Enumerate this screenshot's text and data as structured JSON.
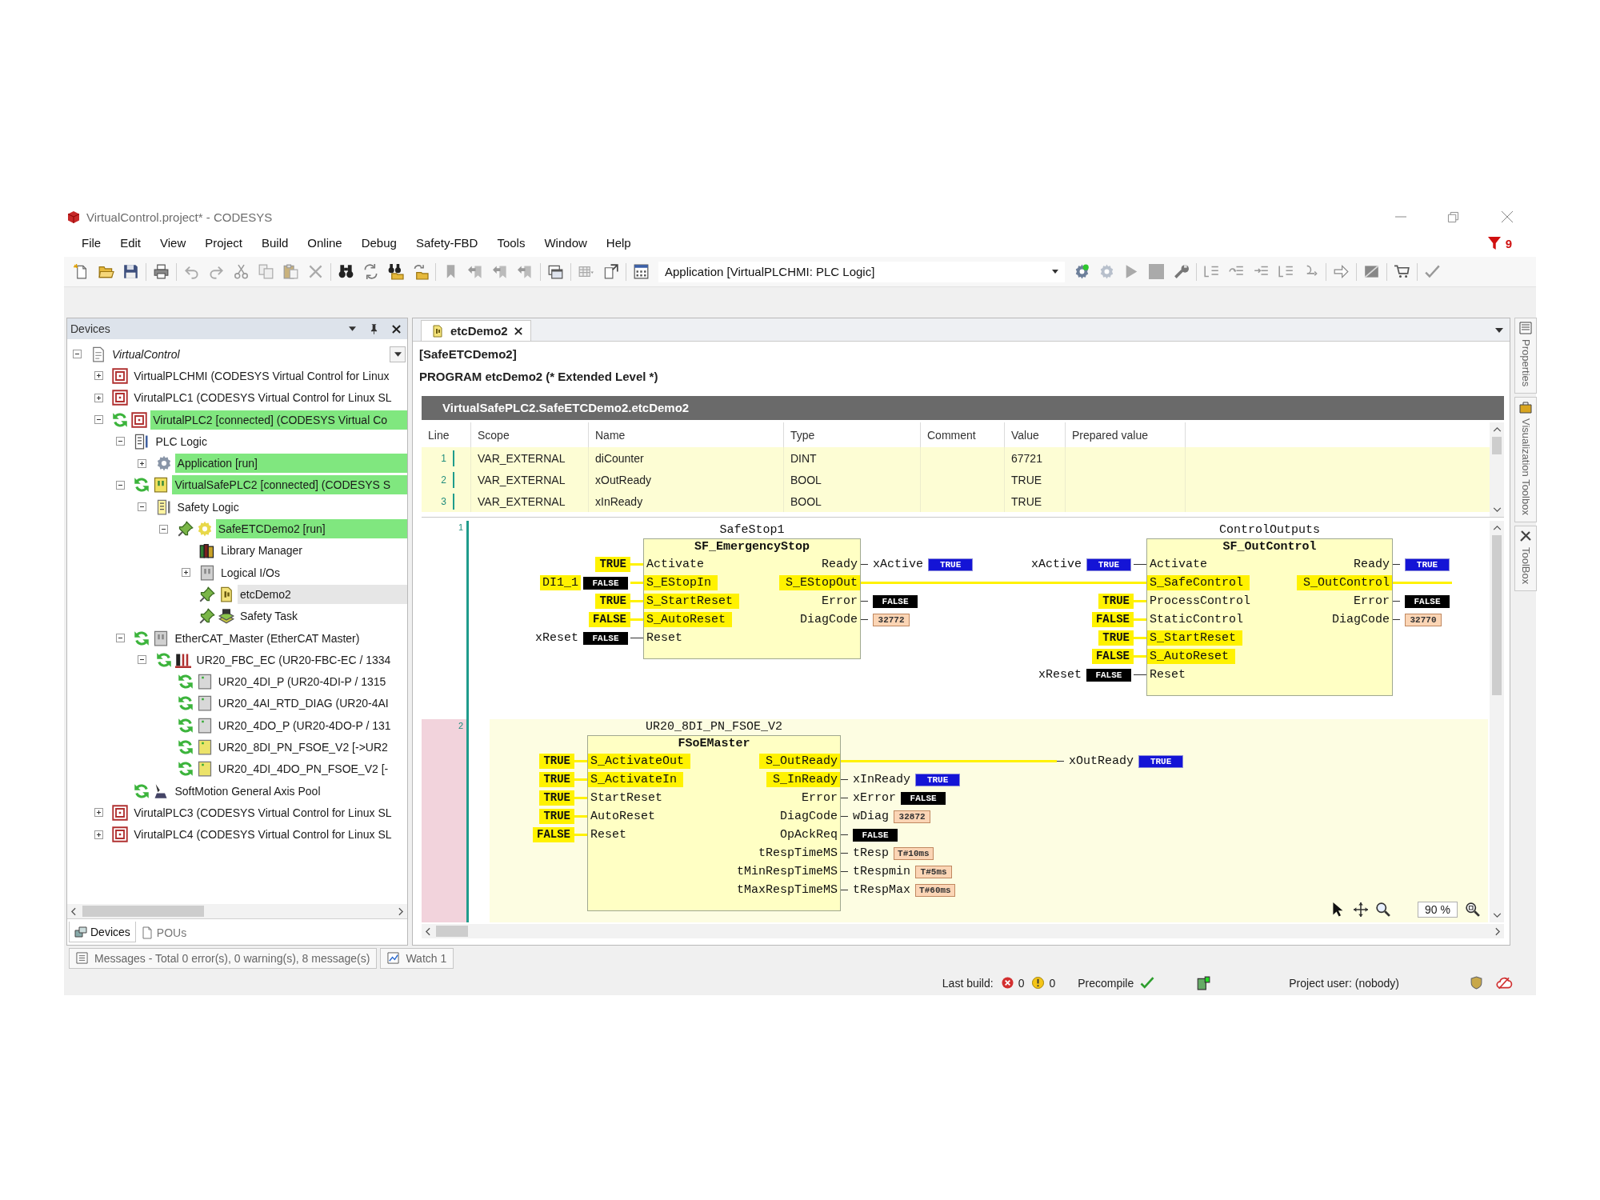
{
  "window": {
    "title": "VirtualControl.project* - CODESYS"
  },
  "menu": [
    "File",
    "Edit",
    "View",
    "Project",
    "Build",
    "Online",
    "Debug",
    "Safety-FBD",
    "Tools",
    "Window",
    "Help"
  ],
  "messages_filter": {
    "count": "9"
  },
  "toolbar": {
    "application": "Application [VirtualPLCHMI: PLC Logic]"
  },
  "devices_panel": {
    "title": "Devices",
    "tree": [
      {
        "label": "VirtualControl",
        "kind": "project",
        "expanded": true,
        "active": false,
        "selected": false,
        "synced": false,
        "pinned": false,
        "children": [
          {
            "label": "VirtualPLCHMI (CODESYS Virtual Control for Linux",
            "kind": "plc",
            "expanded": false,
            "active": false,
            "selected": false,
            "synced": false,
            "pinned": false
          },
          {
            "label": "VirutalPLC1 (CODESYS Virtual Control for Linux SL",
            "kind": "plc",
            "expanded": false,
            "active": false,
            "selected": false,
            "synced": false,
            "pinned": false
          },
          {
            "label": "VirutalPLC2 [connected] (CODESYS Virtual Co",
            "kind": "plc",
            "expanded": true,
            "active": true,
            "selected": false,
            "synced": true,
            "pinned": false,
            "children": [
              {
                "label": "PLC Logic",
                "kind": "logic",
                "expanded": true,
                "active": false,
                "selected": false,
                "synced": false,
                "pinned": false,
                "children": [
                  {
                    "label": "Application [run]",
                    "kind": "application",
                    "expanded": false,
                    "active": true,
                    "selected": false,
                    "synced": false,
                    "pinned": false
                  }
                ]
              },
              {
                "label": "VirtualSafePLC2 [connected] (CODESYS S",
                "kind": "safeplc",
                "expanded": true,
                "active": true,
                "selected": false,
                "synced": true,
                "pinned": false,
                "children": [
                  {
                    "label": "Safety Logic",
                    "kind": "safelogic",
                    "expanded": true,
                    "active": false,
                    "selected": false,
                    "synced": false,
                    "pinned": false,
                    "children": [
                      {
                        "label": "SafeETCDemo2 [run]",
                        "kind": "safeapp",
                        "expanded": true,
                        "active": true,
                        "selected": false,
                        "synced": false,
                        "pinned": true,
                        "children": [
                          {
                            "label": "Library Manager",
                            "kind": "library",
                            "active": false,
                            "selected": false,
                            "synced": false,
                            "pinned": false
                          },
                          {
                            "label": "Logical I/Os",
                            "kind": "io",
                            "expanded": false,
                            "active": false,
                            "selected": false,
                            "synced": false,
                            "pinned": false
                          },
                          {
                            "label": "etcDemo2",
                            "kind": "pou",
                            "active": false,
                            "selected": true,
                            "synced": false,
                            "pinned": true
                          },
                          {
                            "label": "Safety Task",
                            "kind": "task",
                            "active": false,
                            "selected": false,
                            "synced": false,
                            "pinned": true
                          }
                        ]
                      }
                    ]
                  }
                ]
              },
              {
                "label": "EtherCAT_Master (EtherCAT Master)",
                "kind": "master",
                "expanded": true,
                "active": false,
                "selected": false,
                "synced": true,
                "pinned": false,
                "children": [
                  {
                    "label": "UR20_FBC_EC (UR20-FBC-EC / 1334",
                    "kind": "coupler",
                    "expanded": true,
                    "active": false,
                    "selected": false,
                    "synced": true,
                    "pinned": false,
                    "children": [
                      {
                        "label": "UR20_4DI_P (UR20-4DI-P / 1315",
                        "kind": "module",
                        "active": false,
                        "selected": false,
                        "synced": true,
                        "pinned": false
                      },
                      {
                        "label": "UR20_4AI_RTD_DIAG (UR20-4AI",
                        "kind": "module",
                        "active": false,
                        "selected": false,
                        "synced": true,
                        "pinned": false
                      },
                      {
                        "label": "UR20_4DO_P (UR20-4DO-P / 131",
                        "kind": "module",
                        "active": false,
                        "selected": false,
                        "synced": true,
                        "pinned": false
                      },
                      {
                        "label": "UR20_8DI_PN_FSOE_V2 [->UR2",
                        "kind": "safemodule",
                        "active": false,
                        "selected": false,
                        "synced": true,
                        "pinned": false
                      },
                      {
                        "label": "UR20_4DI_4DO_PN_FSOE_V2 [-",
                        "kind": "safemodule",
                        "active": false,
                        "selected": false,
                        "synced": true,
                        "pinned": false
                      }
                    ]
                  }
                ]
              },
              {
                "label": "SoftMotion General Axis Pool",
                "kind": "axispool",
                "active": false,
                "selected": false,
                "synced": true,
                "pinned": false
              }
            ]
          },
          {
            "label": "VirutalPLC3 (CODESYS Virtual Control for Linux SL",
            "kind": "plc",
            "expanded": false,
            "active": false,
            "selected": false,
            "synced": false,
            "pinned": false
          },
          {
            "label": "VirutalPLC4 (CODESYS Virtual Control for Linux SL",
            "kind": "plc",
            "expanded": false,
            "active": false,
            "selected": false,
            "synced": false,
            "pinned": false
          }
        ]
      }
    ],
    "tabs": [
      {
        "label": "Devices",
        "selected": true
      },
      {
        "label": "POUs",
        "selected": false
      }
    ]
  },
  "editor": {
    "tab": {
      "label": "etcDemo2",
      "selected": true
    },
    "path": "[SafeETCDemo2]",
    "declaration": "PROGRAM etcDemo2 (* Extended Level *)",
    "instance_path": "VirtualSafePLC2.SafeETCDemo2.etcDemo2",
    "table": {
      "columns": [
        "Line",
        "Scope",
        "Name",
        "Type",
        "Comment",
        "Value",
        "Prepared value"
      ],
      "rows": [
        {
          "line": "1",
          "scope": "VAR_EXTERNAL",
          "name": "diCounter",
          "type": "DINT",
          "value": "67721"
        },
        {
          "line": "2",
          "scope": "VAR_EXTERNAL",
          "name": "xOutReady",
          "type": "BOOL",
          "value": "TRUE"
        },
        {
          "line": "3",
          "scope": "VAR_EXTERNAL",
          "name": "xInReady",
          "type": "BOOL",
          "value": "TRUE"
        }
      ]
    },
    "networks": [
      {
        "number": "1",
        "selected": false,
        "blocks": [
          {
            "instance": "SafeStop1",
            "type": "SF_EmergencyStop",
            "inputs": [
              {
                "pin": "Activate",
                "safe": false,
                "kind": "constant",
                "text": "TRUE"
              },
              {
                "pin": "S_EStopIn",
                "safe": true,
                "kind": "variable",
                "variable": "DI1_1",
                "variable_safe": true,
                "value": "FALSE",
                "on": false
              },
              {
                "pin": "S_StartReset",
                "safe": true,
                "kind": "constant",
                "text": "TRUE"
              },
              {
                "pin": "S_AutoReset",
                "safe": true,
                "kind": "constant",
                "text": "FALSE"
              },
              {
                "pin": "Reset",
                "safe": false,
                "kind": "variable",
                "variable": "xReset",
                "variable_safe": false,
                "value": "FALSE",
                "on": false
              }
            ],
            "outputs": [
              {
                "pin": "Ready",
                "safe": false,
                "kind": "variable",
                "variable": "xActive",
                "variable_safe": false,
                "value": "TRUE",
                "on": true
              },
              {
                "pin": "S_EStopOut",
                "safe": true,
                "kind": "link"
              },
              {
                "pin": "Error",
                "safe": false,
                "kind": "value",
                "value": "FALSE",
                "on": false
              },
              {
                "pin": "DiagCode",
                "safe": false,
                "kind": "value",
                "value": "32772"
              }
            ]
          },
          {
            "instance": "ControlOutputs",
            "type": "SF_OutControl",
            "inputs": [
              {
                "pin": "Activate",
                "safe": false,
                "kind": "variable",
                "variable": "xActive",
                "variable_safe": false,
                "value": "TRUE",
                "on": true
              },
              {
                "pin": "S_SafeControl",
                "safe": true,
                "kind": "link"
              },
              {
                "pin": "ProcessControl",
                "safe": false,
                "kind": "constant",
                "text": "TRUE"
              },
              {
                "pin": "StaticControl",
                "safe": false,
                "kind": "constant",
                "text": "FALSE"
              },
              {
                "pin": "S_StartReset",
                "safe": true,
                "kind": "constant",
                "text": "TRUE"
              },
              {
                "pin": "S_AutoReset",
                "safe": true,
                "kind": "constant",
                "text": "FALSE"
              },
              {
                "pin": "Reset",
                "safe": false,
                "kind": "variable",
                "variable": "xReset",
                "variable_safe": false,
                "value": "FALSE",
                "on": false
              }
            ],
            "outputs": [
              {
                "pin": "Ready",
                "safe": false,
                "kind": "value",
                "value": "TRUE",
                "on": true
              },
              {
                "pin": "S_OutControl",
                "safe": true,
                "kind": "link"
              },
              {
                "pin": "Error",
                "safe": false,
                "kind": "value",
                "value": "FALSE",
                "on": false
              },
              {
                "pin": "DiagCode",
                "safe": false,
                "kind": "value",
                "value": "32770"
              }
            ]
          }
        ]
      },
      {
        "number": "2",
        "selected": true,
        "blocks": [
          {
            "instance": "UR20_8DI_PN_FSOE_V2",
            "type": "FSoEMaster",
            "inputs": [
              {
                "pin": "S_ActivateOut",
                "safe": true,
                "kind": "constant",
                "text": "TRUE"
              },
              {
                "pin": "S_ActivateIn",
                "safe": true,
                "kind": "constant",
                "text": "TRUE"
              },
              {
                "pin": "StartReset",
                "safe": false,
                "kind": "constant",
                "text": "TRUE"
              },
              {
                "pin": "AutoReset",
                "safe": false,
                "kind": "constant",
                "text": "TRUE"
              },
              {
                "pin": "Reset",
                "safe": false,
                "kind": "constant",
                "text": "FALSE"
              }
            ],
            "outputs": [
              {
                "pin": "S_OutReady",
                "safe": true,
                "kind": "far_variable",
                "variable": "xOutReady",
                "variable_safe": false,
                "value": "TRUE",
                "on": true
              },
              {
                "pin": "S_InReady",
                "safe": true,
                "kind": "variable",
                "variable": "xInReady",
                "variable_safe": false,
                "value": "TRUE",
                "on": true
              },
              {
                "pin": "Error",
                "safe": false,
                "kind": "variable",
                "variable": "xError",
                "variable_safe": false,
                "value": "FALSE",
                "on": false
              },
              {
                "pin": "DiagCode",
                "safe": false,
                "kind": "variable",
                "variable": "wDiag",
                "variable_safe": false,
                "value": "32872"
              },
              {
                "pin": "OpAckReq",
                "safe": false,
                "kind": "value",
                "value": "FALSE",
                "on": false
              },
              {
                "pin": "tRespTimeMS",
                "safe": false,
                "kind": "variable",
                "variable": "tResp",
                "variable_safe": false,
                "value": "T#10ms"
              },
              {
                "pin": "tMinRespTimeMS",
                "safe": false,
                "kind": "variable",
                "variable": "tRespmin",
                "variable_safe": false,
                "value": "T#5ms"
              },
              {
                "pin": "tMaxRespTimeMS",
                "safe": false,
                "kind": "variable",
                "variable": "tRespMax",
                "variable_safe": false,
                "value": "T#60ms"
              }
            ]
          }
        ]
      }
    ],
    "zoom": "90 %"
  },
  "side_tabs": [
    "Properties",
    "Visualization Toolbox",
    "ToolBox"
  ],
  "bottom_tabs": [
    "Messages - Total 0 error(s), 0 warning(s), 8 message(s)",
    "Watch 1"
  ],
  "status_bar": {
    "last_build": "Last build:",
    "errors": "0",
    "warnings": "0",
    "precompile": "Precompile",
    "project_user": "Project user: (nobody)"
  }
}
